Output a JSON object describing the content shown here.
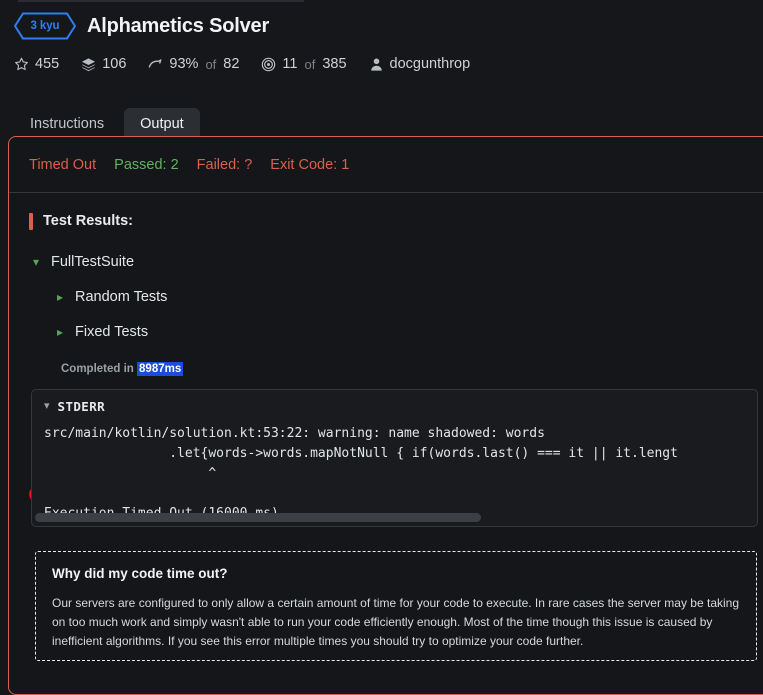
{
  "header": {
    "kyu_badge": "3 kyu",
    "title": "Alphametics Solver",
    "stats": [
      {
        "icon": "star-icon",
        "value": "455",
        "sep": "",
        "value2": ""
      },
      {
        "icon": "layers-icon",
        "value": "106",
        "sep": "",
        "value2": ""
      },
      {
        "icon": "speedometer-icon",
        "value": "93%",
        "sep": "of",
        "value2": "82"
      },
      {
        "icon": "target-icon",
        "value": "11",
        "sep": "of",
        "value2": "385"
      },
      {
        "icon": "user-icon",
        "value": "docgunthrop",
        "sep": "",
        "value2": ""
      }
    ]
  },
  "tabs": [
    {
      "label": "Instructions",
      "active": false
    },
    {
      "label": "Output",
      "active": true
    }
  ],
  "status_bar": {
    "timed_out": "Timed Out",
    "passed": "Passed: 2",
    "failed": "Failed: ?",
    "exit_code": "Exit Code: 1"
  },
  "test_results": {
    "heading": "Test Results:",
    "tree": [
      {
        "label": "FullTestSuite",
        "chevron": "chevron-down-icon",
        "level": 1
      },
      {
        "label": "Random Tests",
        "chevron": "chevron-right-icon",
        "level": 2
      },
      {
        "label": "Fixed Tests",
        "chevron": "chevron-right-icon",
        "level": 2
      }
    ],
    "completed_prefix": "Completed in ",
    "completed_duration": "8987ms"
  },
  "stderr": {
    "title": "STDERR",
    "chevron": "chevron-down-icon",
    "body": "src/main/kotlin/solution.kt:53:22: warning: name shadowed: words\n                .let{words->words.mapNotNull { if(words.last() === it || it.lengt\n                     ^\n\nExecution Timed Out (16000 ms)"
  },
  "info_box": {
    "title": "Why did my code time out?",
    "text": "Our servers are configured to only allow a certain amount of time for your code to execute. In rare cases the server may be taking on too much work and simply wasn't able to run your code efficiently enough. Most of the time though this issue is caused by inefficient algorithms. If you see this error multiple times you should try to optimize your code further."
  },
  "colors": {
    "background": "#15171a",
    "accent_blue": "#2f7ff0",
    "error_red": "#d9604a",
    "success_green": "#5fb35f",
    "highlight_blue": "#1a4ed8",
    "annotation_red": "#f01010"
  }
}
